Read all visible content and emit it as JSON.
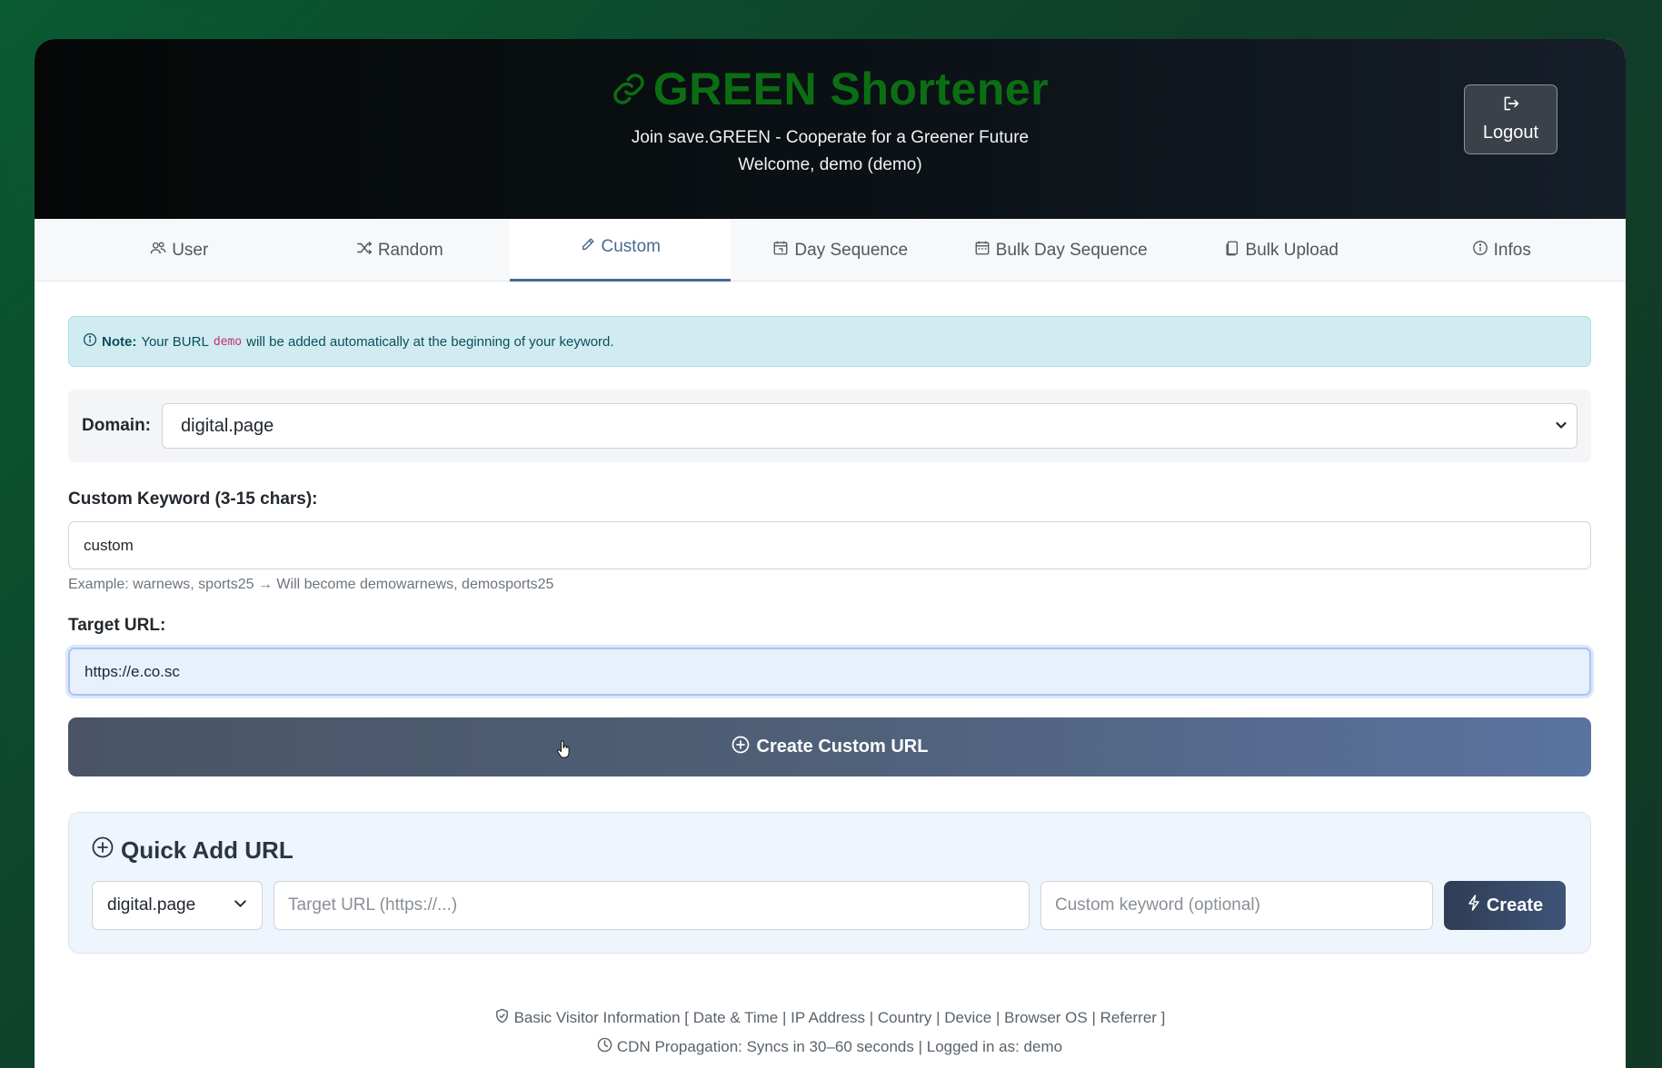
{
  "header": {
    "brand_icon": "link-icon",
    "title": "GREEN Shortener",
    "tagline": "Join save.GREEN - Cooperate for a Greener Future",
    "welcome": "Welcome, demo (demo)",
    "logout_label": "Logout",
    "brand_color": "#0c6e12"
  },
  "tabs": [
    {
      "label": "User",
      "icon": "users-icon",
      "active": false
    },
    {
      "label": "Random",
      "icon": "shuffle-icon",
      "active": false
    },
    {
      "label": "Custom",
      "icon": "pencil-icon",
      "active": true
    },
    {
      "label": "Day Sequence",
      "icon": "calendar-icon",
      "active": false
    },
    {
      "label": "Bulk Day Sequence",
      "icon": "calendar-range-icon",
      "active": false
    },
    {
      "label": "Bulk Upload",
      "icon": "files-icon",
      "active": false
    },
    {
      "label": "Infos",
      "icon": "info-icon",
      "active": false
    }
  ],
  "note": {
    "label": "Note:",
    "text_before": "Your BURL",
    "code": "demo",
    "text_after": "will be added automatically at the beginning of your keyword."
  },
  "domain": {
    "label": "Domain:",
    "selected": "digital.page"
  },
  "keyword": {
    "label": "Custom Keyword (3-15 chars):",
    "value": "custom",
    "help": "Example: warnews, sports25 → Will become demowarnews, demosports25"
  },
  "target": {
    "label": "Target URL:",
    "value": "https://e.co.sc"
  },
  "create_button": "Create Custom URL",
  "quick_add": {
    "title": "Quick Add URL",
    "domain": "digital.page",
    "target_placeholder": "Target URL (https://...)",
    "keyword_placeholder": "Custom keyword (optional)",
    "create_label": "Create"
  },
  "footer": {
    "visitor_info": "Basic Visitor Information [ Date & Time | IP Address | Country | Device | Browser OS | Referrer ]",
    "cdn": "CDN Propagation: Syncs in 30–60 seconds | Logged in as: demo"
  }
}
